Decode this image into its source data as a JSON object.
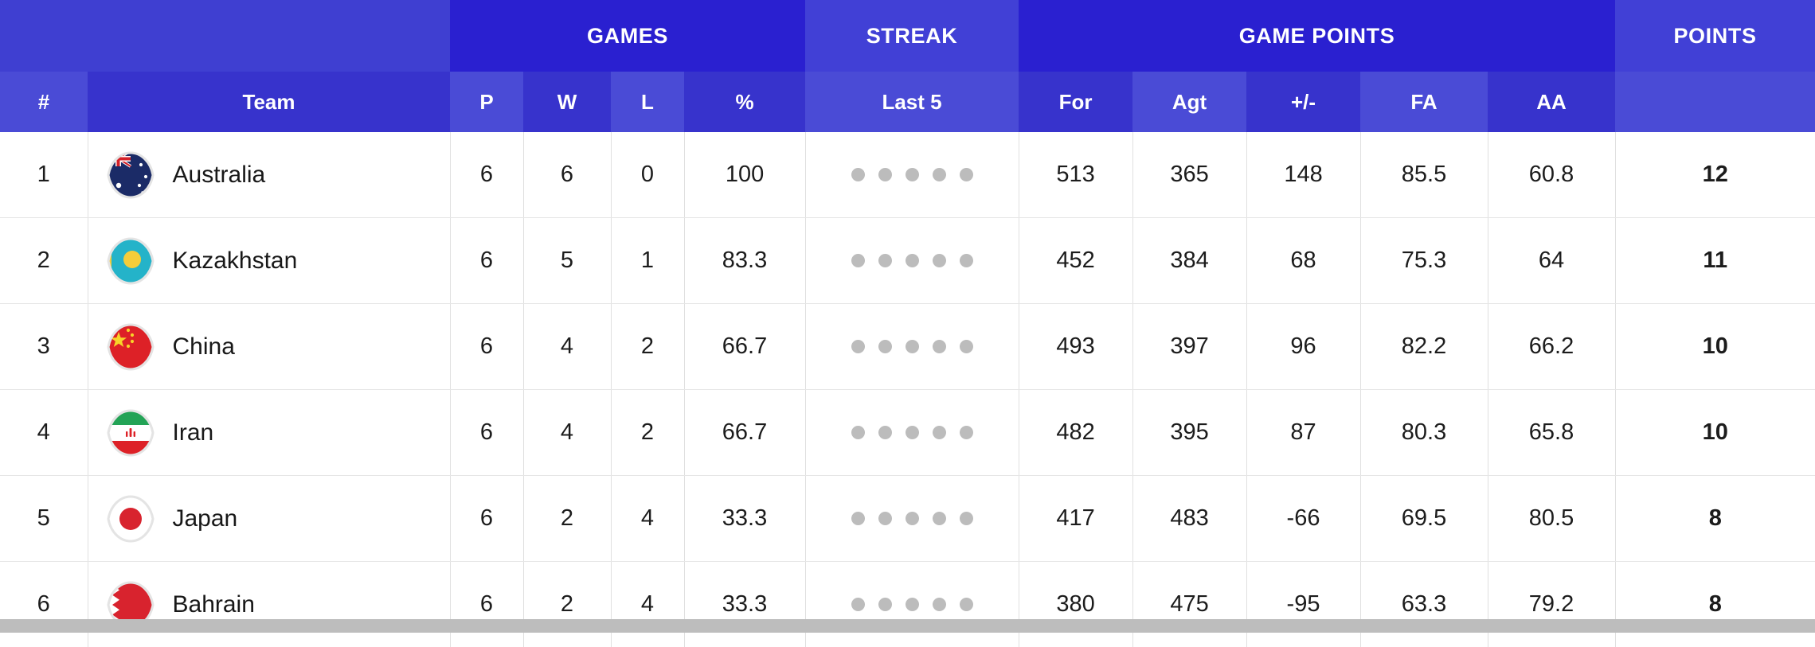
{
  "table": {
    "group_headers": [
      {
        "label": "",
        "span": 2,
        "style": "blank"
      },
      {
        "label": "GAMES",
        "span": 4,
        "style": "games"
      },
      {
        "label": "STREAK",
        "span": 1,
        "style": "streak"
      },
      {
        "label": "GAME POINTS",
        "span": 5,
        "style": "gamepoints"
      },
      {
        "label": "POINTS",
        "span": 1,
        "style": "points"
      }
    ],
    "columns": [
      {
        "key": "rank",
        "label": "#",
        "shade": "light"
      },
      {
        "key": "team",
        "label": "Team",
        "shade": "team"
      },
      {
        "key": "p",
        "label": "P",
        "shade": "light"
      },
      {
        "key": "w",
        "label": "W",
        "shade": "dark"
      },
      {
        "key": "l",
        "label": "L",
        "shade": "light"
      },
      {
        "key": "pct",
        "label": "%",
        "shade": "dark"
      },
      {
        "key": "last5",
        "label": "Last 5",
        "shade": "light"
      },
      {
        "key": "for",
        "label": "For",
        "shade": "dark"
      },
      {
        "key": "agt",
        "label": "Agt",
        "shade": "light"
      },
      {
        "key": "plusminus",
        "label": "+/-",
        "shade": "dark"
      },
      {
        "key": "fa",
        "label": "FA",
        "shade": "light"
      },
      {
        "key": "aa",
        "label": "AA",
        "shade": "dark"
      },
      {
        "key": "points",
        "label": "",
        "shade": "light"
      }
    ],
    "streak_dot_count": 5,
    "rows": [
      {
        "rank": "1",
        "team": "Australia",
        "flag": "flag-australia-icon",
        "p": "6",
        "w": "6",
        "l": "0",
        "pct": "100",
        "for": "513",
        "agt": "365",
        "plusminus": "148",
        "fa": "85.5",
        "aa": "60.8",
        "points": "12"
      },
      {
        "rank": "2",
        "team": "Kazakhstan",
        "flag": "flag-kazakhstan-icon",
        "p": "6",
        "w": "5",
        "l": "1",
        "pct": "83.3",
        "for": "452",
        "agt": "384",
        "plusminus": "68",
        "fa": "75.3",
        "aa": "64",
        "points": "11"
      },
      {
        "rank": "3",
        "team": "China",
        "flag": "flag-china-icon",
        "p": "6",
        "w": "4",
        "l": "2",
        "pct": "66.7",
        "for": "493",
        "agt": "397",
        "plusminus": "96",
        "fa": "82.2",
        "aa": "66.2",
        "points": "10"
      },
      {
        "rank": "4",
        "team": "Iran",
        "flag": "flag-iran-icon",
        "p": "6",
        "w": "4",
        "l": "2",
        "pct": "66.7",
        "for": "482",
        "agt": "395",
        "plusminus": "87",
        "fa": "80.3",
        "aa": "65.8",
        "points": "10"
      },
      {
        "rank": "5",
        "team": "Japan",
        "flag": "flag-japan-icon",
        "p": "6",
        "w": "2",
        "l": "4",
        "pct": "33.3",
        "for": "417",
        "agt": "483",
        "plusminus": "-66",
        "fa": "69.5",
        "aa": "80.5",
        "points": "8"
      },
      {
        "rank": "6",
        "team": "Bahrain",
        "flag": "flag-bahrain-icon",
        "p": "6",
        "w": "2",
        "l": "4",
        "pct": "33.3",
        "for": "380",
        "agt": "475",
        "plusminus": "-95",
        "fa": "63.3",
        "aa": "79.2",
        "points": "8"
      }
    ]
  },
  "colors": {
    "header_band_dark": "#2a20d0",
    "header_band_light": "#4140d6",
    "col_header_dark": "#3733cc",
    "col_header_light": "#4a4bd6",
    "row_background": "#ffffff",
    "row_divider": "#e6e6e6",
    "streak_dot": "#bcbcbc",
    "scrollbar": "#bdbdbd"
  }
}
